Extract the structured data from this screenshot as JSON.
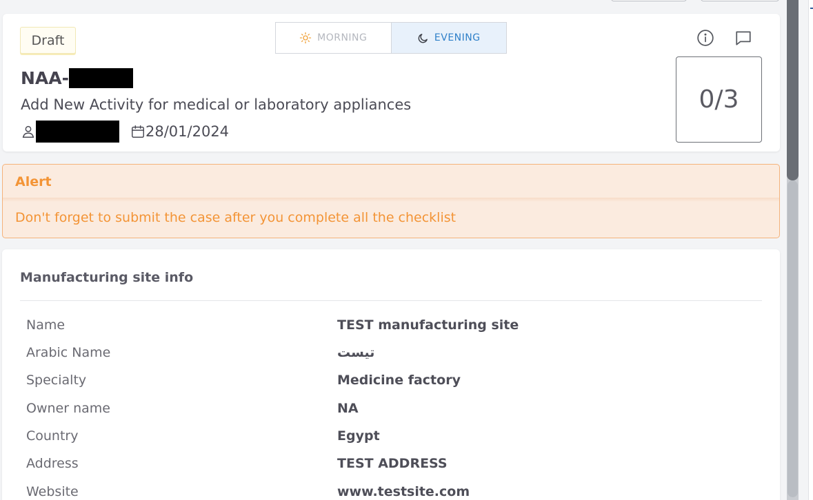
{
  "header": {
    "status_badge": "Draft",
    "shift_toggle": {
      "morning_label": "MORNING",
      "evening_label": "EVENING",
      "selected": "EVENING"
    },
    "case_code_prefix": "NAA-",
    "case_title": "Add New Activity for medical or laboratory appliances",
    "date": "28/01/2024",
    "checklist_counter": "0/3"
  },
  "alert": {
    "title": "Alert",
    "message": "Don't forget to submit the case after you complete all the checklist"
  },
  "site_info": {
    "section_title": "Manufacturing site info",
    "rows": [
      {
        "label": "Name",
        "value": "TEST manufacturing site"
      },
      {
        "label": "Arabic Name",
        "value": "تيست"
      },
      {
        "label": "Specialty",
        "value": "Medicine factory"
      },
      {
        "label": "Owner name",
        "value": "NA"
      },
      {
        "label": "Country",
        "value": "Egypt"
      },
      {
        "label": "Address",
        "value": "TEST ADDRESS"
      },
      {
        "label": "Website",
        "value": "www.testsite.com"
      }
    ]
  },
  "colors": {
    "alert_text": "#f39436",
    "alert_bg": "#fbebdf",
    "evening_accent": "#2f80c9",
    "morning_icon": "#f0a23a"
  },
  "icons": {
    "morning": "sun-icon",
    "evening": "moon-icon",
    "info": "info-icon",
    "comment": "comment-icon",
    "user": "user-icon",
    "date": "calendar-icon"
  }
}
